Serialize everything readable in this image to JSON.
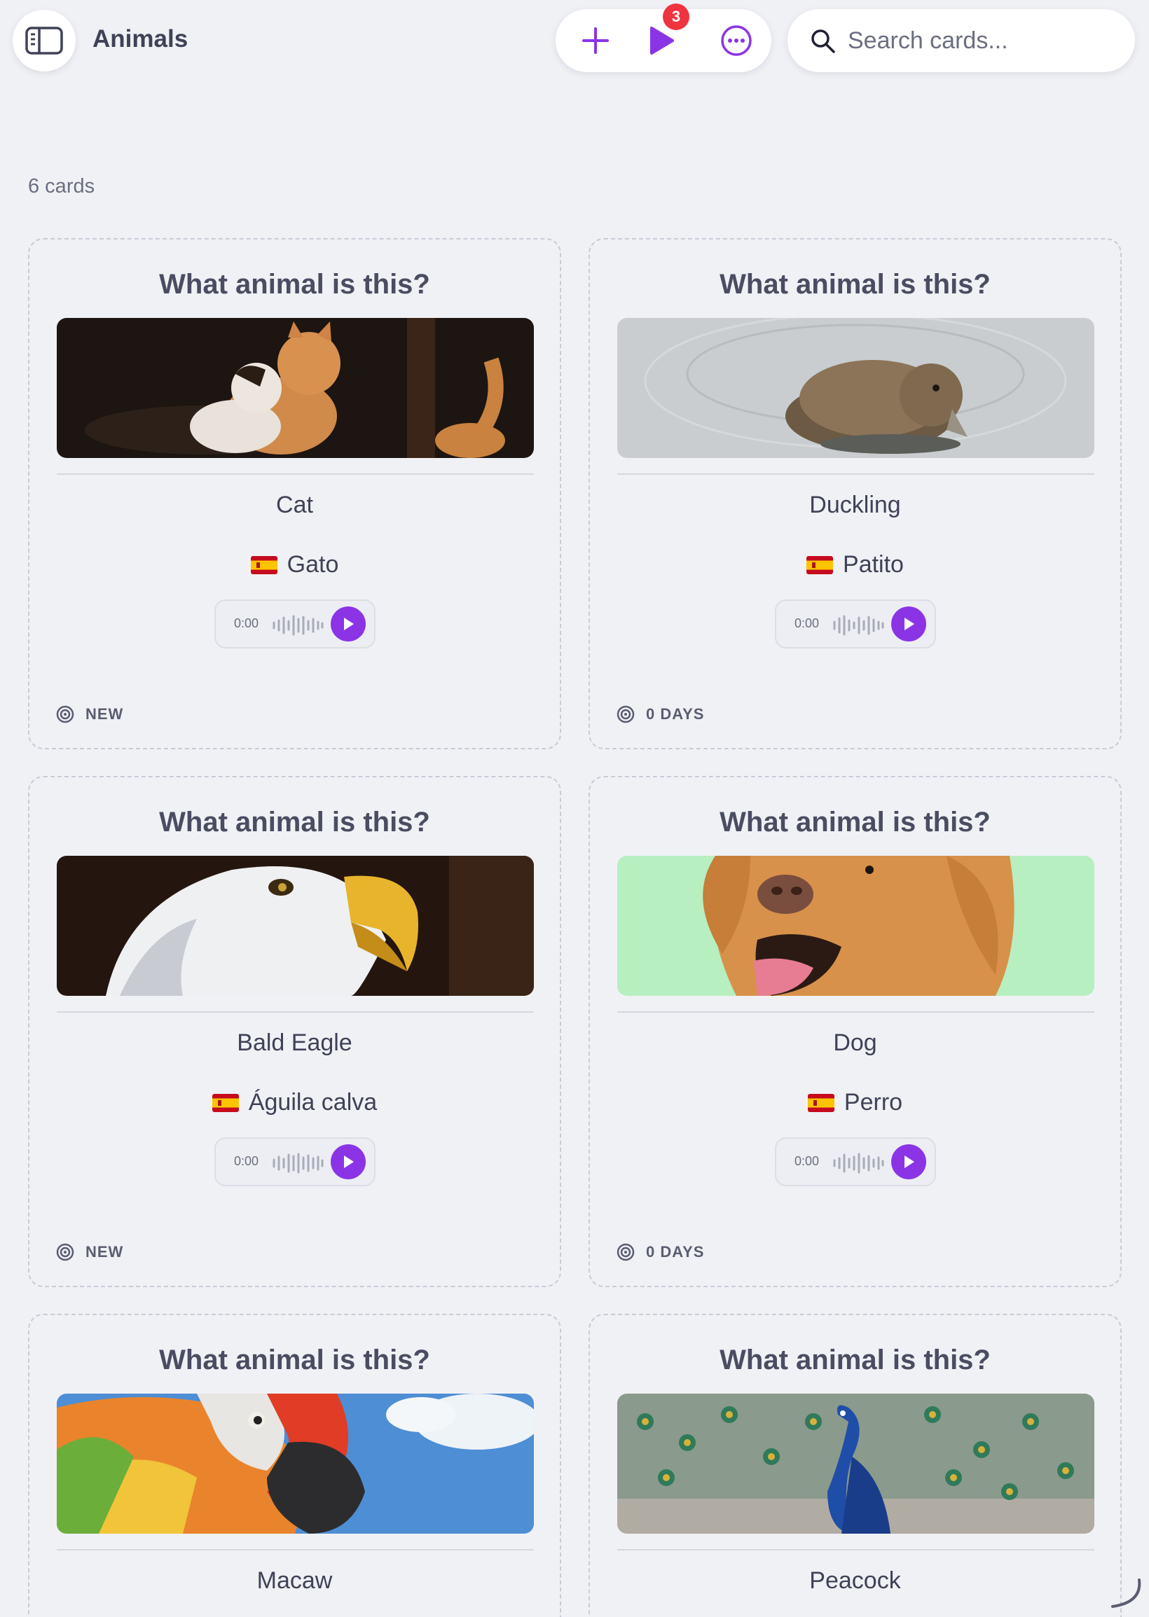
{
  "header": {
    "title": "Animals",
    "badge_count": "3",
    "search_placeholder": "Search cards..."
  },
  "deck": {
    "count_label": "6 cards"
  },
  "colors": {
    "accent": "#8b34e6",
    "badge": "#ef3340",
    "background": "#f0f1f5"
  },
  "cards": [
    {
      "question": "What animal is this?",
      "image": "kittens-photo",
      "answer": "Cat",
      "translation": "Gato",
      "flag": "spain-flag",
      "audio_time": "0:00",
      "status": "NEW"
    },
    {
      "question": "What animal is this?",
      "image": "duckling-photo",
      "answer": "Duckling",
      "translation": "Patito",
      "flag": "spain-flag",
      "audio_time": "0:00",
      "status": "0 DAYS"
    },
    {
      "question": "What animal is this?",
      "image": "bald-eagle-photo",
      "answer": "Bald Eagle",
      "translation": "Águila calva",
      "flag": "spain-flag",
      "audio_time": "0:00",
      "status": "NEW"
    },
    {
      "question": "What animal is this?",
      "image": "dog-photo",
      "answer": "Dog",
      "translation": "Perro",
      "flag": "spain-flag",
      "audio_time": "0:00",
      "status": "0 DAYS"
    },
    {
      "question": "What animal is this?",
      "image": "macaw-photo",
      "answer": "Macaw"
    },
    {
      "question": "What animal is this?",
      "image": "peacock-photo",
      "answer": "Peacock"
    }
  ]
}
